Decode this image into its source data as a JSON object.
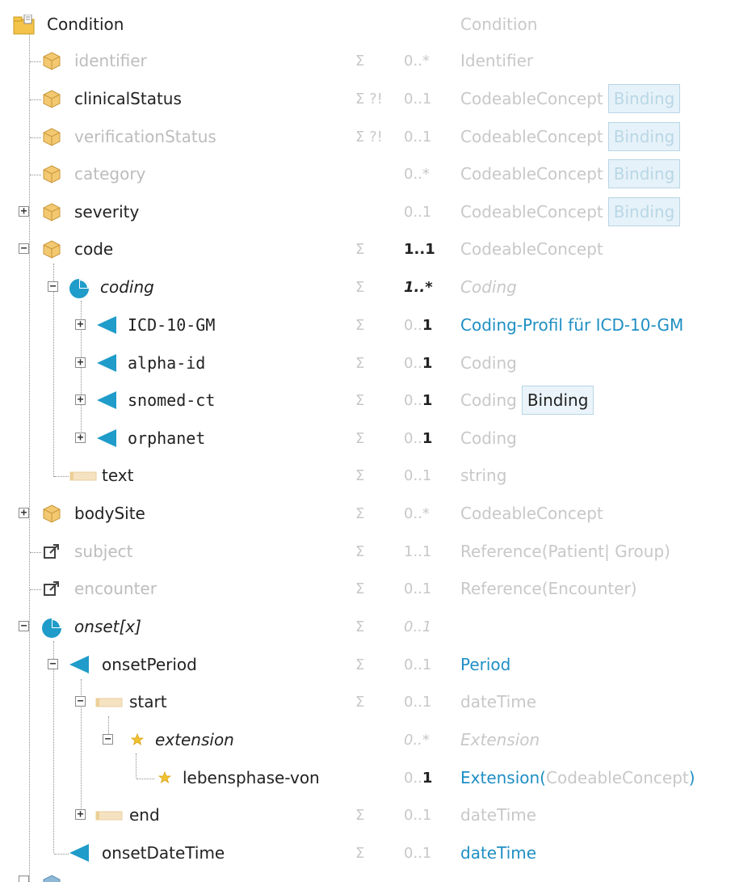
{
  "tree": {
    "rows": [
      {
        "name": "Condition",
        "style": "normal",
        "icon": "folder-icon",
        "flags": "",
        "card": "",
        "card_bold": false,
        "type": "Condition",
        "type_style": "muted",
        "binding": "",
        "type_tail": ""
      },
      {
        "name": "identifier",
        "style": "muted",
        "icon": "element-icon",
        "flags": "Σ",
        "card": "0..*",
        "type": "Identifier",
        "type_style": "muted",
        "binding": "",
        "type_tail": ""
      },
      {
        "name": "clinicalStatus",
        "style": "normal",
        "icon": "element-icon",
        "flags": "Σ ?!",
        "card": "0..1",
        "type": "CodeableConcept",
        "type_style": "muted",
        "binding": "Binding",
        "type_tail": ""
      },
      {
        "name": "verificationStatus",
        "style": "muted",
        "icon": "element-icon",
        "flags": "Σ ?!",
        "card": "0..1",
        "type": "CodeableConcept",
        "type_style": "muted",
        "binding": "Binding",
        "type_tail": ""
      },
      {
        "name": "category",
        "style": "muted",
        "icon": "element-icon",
        "flags": "",
        "card": "0..*",
        "type": "CodeableConcept",
        "type_style": "muted",
        "binding": "Binding",
        "type_tail": ""
      },
      {
        "name": "severity",
        "style": "normal",
        "icon": "element-icon",
        "flags": "",
        "card": "0..1",
        "type": "CodeableConcept",
        "type_style": "muted",
        "binding": "Binding",
        "type_tail": ""
      },
      {
        "name": "code",
        "style": "normal",
        "icon": "element-icon",
        "flags": "Σ",
        "card_pre": "1..",
        "card_b": "1",
        "type": "CodeableConcept",
        "type_style": "muted",
        "binding": "",
        "type_tail": ""
      },
      {
        "name": "coding",
        "style": "italic",
        "icon": "slice-icon",
        "flags": "Σ",
        "card": "1..*",
        "type": "Coding",
        "type_style": "italic",
        "binding": "",
        "type_tail": ""
      },
      {
        "name": "ICD-10-GM",
        "style": "mono",
        "icon": "slice-item-icon",
        "flags": "Σ",
        "card_pre": "0..",
        "card_b": "1",
        "type": "Coding-Profil für ICD-10-GM",
        "type_style": "link",
        "binding": "",
        "type_tail": ""
      },
      {
        "name": "alpha-id",
        "style": "mono",
        "icon": "slice-item-icon",
        "flags": "Σ",
        "card_pre": "0..",
        "card_b": "1",
        "type": "Coding",
        "type_style": "muted",
        "binding": "",
        "type_tail": ""
      },
      {
        "name": "snomed-ct",
        "style": "mono",
        "icon": "slice-item-icon",
        "flags": "Σ",
        "card_pre": "0..",
        "card_b": "1",
        "type": "Coding",
        "type_style": "muted",
        "binding": "Binding",
        "type_tail": ""
      },
      {
        "name": "orphanet",
        "style": "mono",
        "icon": "slice-item-icon",
        "flags": "Σ",
        "card_pre": "0..",
        "card_b": "1",
        "type": "Coding",
        "type_style": "muted",
        "binding": "",
        "type_tail": ""
      },
      {
        "name": "text",
        "style": "normal",
        "icon": "primitive-icon",
        "flags": "Σ",
        "card": "0..1",
        "type": "string",
        "type_style": "muted",
        "binding": "",
        "type_tail": ""
      },
      {
        "name": "bodySite",
        "style": "normal",
        "icon": "element-icon",
        "flags": "Σ",
        "card": "0..*",
        "type": "CodeableConcept",
        "type_style": "muted",
        "binding": "",
        "type_tail": ""
      },
      {
        "name": "subject",
        "style": "muted",
        "icon": "reference-icon",
        "flags": "Σ",
        "card": "1..1",
        "type": "Reference(Patient| Group)",
        "type_style": "muted",
        "binding": "",
        "type_tail": ""
      },
      {
        "name": "encounter",
        "style": "muted",
        "icon": "reference-icon",
        "flags": "Σ",
        "card": "0..1",
        "type": "Reference(Encounter)",
        "type_style": "muted",
        "binding": "",
        "type_tail": ""
      },
      {
        "name": "onset[x]",
        "style": "italic",
        "icon": "slice-icon",
        "flags": "Σ",
        "card": "0..1",
        "type": "",
        "type_style": "italic",
        "binding": "",
        "type_tail": ""
      },
      {
        "name": "onsetPeriod",
        "style": "normal",
        "icon": "slice-item-icon",
        "flags": "Σ",
        "card": "0..1",
        "type": "Period",
        "type_style": "link",
        "binding": "",
        "type_tail": ""
      },
      {
        "name": "start",
        "style": "normal",
        "icon": "primitive-icon",
        "flags": "Σ",
        "card": "0..1",
        "type": "dateTime",
        "type_style": "muted",
        "binding": "",
        "type_tail": ""
      },
      {
        "name": "extension",
        "style": "italic",
        "icon": "extension-icon",
        "flags": "",
        "card": "0..*",
        "type": "Extension",
        "type_style": "italic",
        "binding": "",
        "type_tail": ""
      },
      {
        "name": "lebensphase-von",
        "style": "normal",
        "icon": "extension-icon",
        "flags": "",
        "card_pre": "0..",
        "card_b": "1",
        "type": "Extension(",
        "type_style": "link",
        "binding": "",
        "type_tail": "CodeableConcept",
        "type_close": ")"
      },
      {
        "name": "end",
        "style": "normal",
        "icon": "primitive-icon",
        "flags": "Σ",
        "card": "0..1",
        "type": "dateTime",
        "type_style": "muted",
        "binding": "",
        "type_tail": ""
      },
      {
        "name": "onsetDateTime",
        "style": "normal",
        "icon": "slice-item-icon",
        "flags": "Σ",
        "card": "0..1",
        "type": "dateTime",
        "type_style": "link",
        "binding": "",
        "type_tail": ""
      }
    ]
  }
}
